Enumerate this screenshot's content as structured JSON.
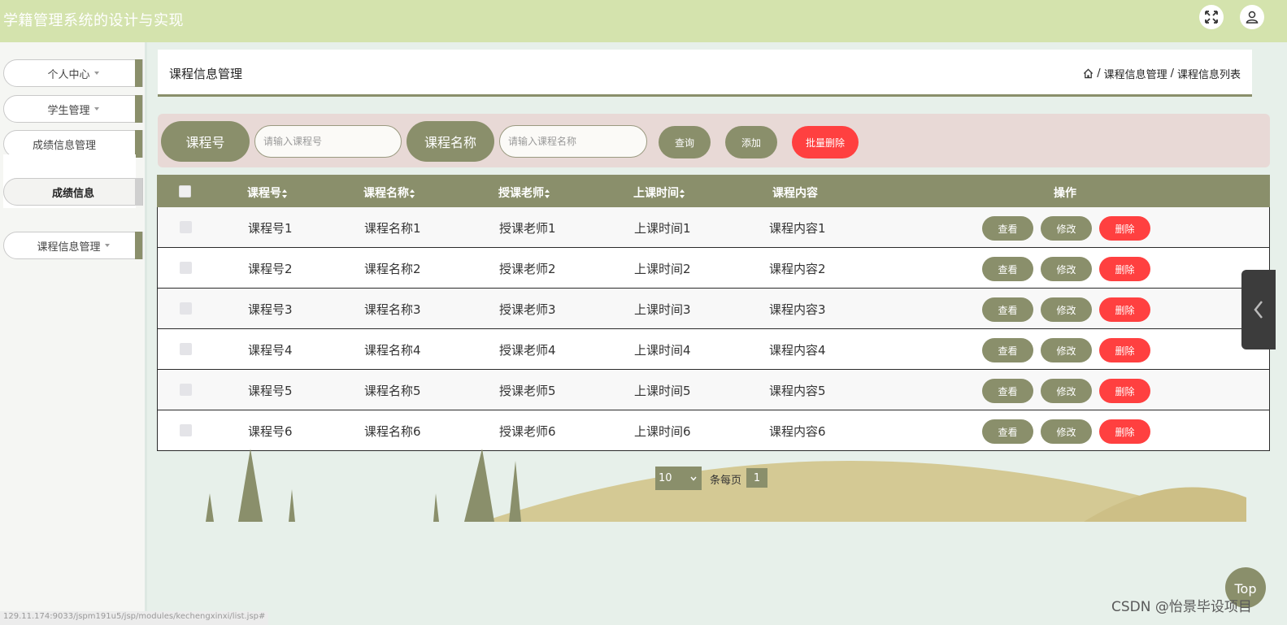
{
  "app": {
    "title": "学籍管理系统的设计与实现"
  },
  "sidebar": {
    "items": [
      {
        "label": "个人中心"
      },
      {
        "label": "学生管理"
      },
      {
        "label": "成绩信息管理"
      },
      {
        "label": "课程信息管理"
      }
    ],
    "submenu": {
      "label": "成绩信息"
    }
  },
  "breadcrumb": {
    "title": "课程信息管理",
    "path": [
      "课程信息管理",
      "课程信息列表"
    ],
    "separator": "/"
  },
  "search": {
    "field1": {
      "label": "课程号",
      "placeholder": "请输入课程号"
    },
    "field2": {
      "label": "课程名称",
      "placeholder": "请输入课程名称"
    },
    "buttons": {
      "query": "查询",
      "add": "添加",
      "batch_delete": "批量删除"
    }
  },
  "table": {
    "headers": [
      "课程号",
      "课程名称",
      "授课老师",
      "上课时间",
      "课程内容",
      "操作"
    ],
    "rows": [
      [
        "课程号1",
        "课程名称1",
        "授课老师1",
        "上课时间1",
        "课程内容1"
      ],
      [
        "课程号2",
        "课程名称2",
        "授课老师2",
        "上课时间2",
        "课程内容2"
      ],
      [
        "课程号3",
        "课程名称3",
        "授课老师3",
        "上课时间3",
        "课程内容3"
      ],
      [
        "课程号4",
        "课程名称4",
        "授课老师4",
        "上课时间4",
        "课程内容4"
      ],
      [
        "课程号5",
        "课程名称5",
        "授课老师5",
        "上课时间5",
        "课程内容5"
      ],
      [
        "课程号6",
        "课程名称6",
        "授课老师6",
        "上课时间6",
        "课程内容6"
      ]
    ],
    "row_actions": {
      "view": "查看",
      "edit": "修改",
      "delete": "删除"
    }
  },
  "pagination": {
    "page_size": "10",
    "label": "条每页",
    "current": "1"
  },
  "floating": {
    "top_label": "Top"
  },
  "watermark": "CSDN @怡景毕设项目",
  "status_url": "129.11.174:9033/jspm191u5/jsp/modules/kechengxinxi/list.jsp#",
  "colors": {
    "accent": "#8a8f6b",
    "topbar": "#d4e3ad",
    "danger": "#ff4040",
    "search_panel": "#e8d9d6",
    "hill": "#d4c994"
  },
  "icons": {
    "fullscreen": "expand-icon",
    "user": "user-icon",
    "home": "home-icon",
    "collapse": "chevron-left-icon"
  }
}
